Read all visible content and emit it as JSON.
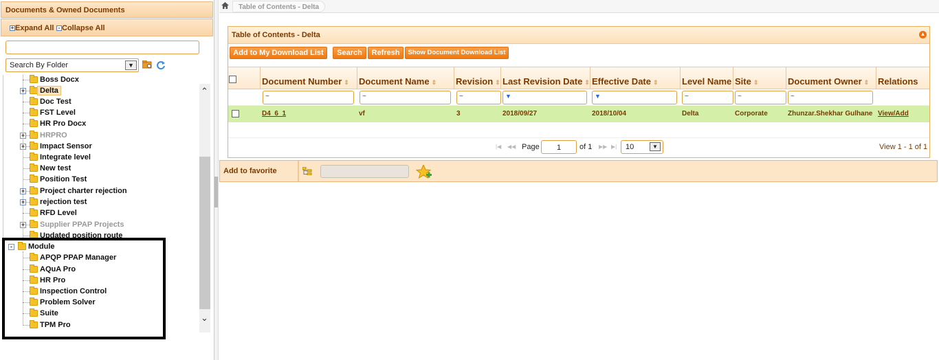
{
  "left_panel": {
    "title": "Documents & Owned Documents",
    "expand_all": "Expand All",
    "collapse_all": "Collapse All",
    "search_text_value": "",
    "search_by": "Search By Folder",
    "tree_items": [
      {
        "label": "Boss Docx"
      },
      {
        "label": "Delta"
      },
      {
        "label": "Doc Test"
      },
      {
        "label": "FST Level"
      },
      {
        "label": "HR Pro Docx"
      },
      {
        "label": "HRPRO"
      },
      {
        "label": "Impact Sensor"
      },
      {
        "label": "Integrate level"
      },
      {
        "label": "New test"
      },
      {
        "label": "Position Test"
      },
      {
        "label": "Project charter rejection"
      },
      {
        "label": "rejection test"
      },
      {
        "label": "RFD Level"
      },
      {
        "label": "Supplier PPAP Projects"
      },
      {
        "label": "Updated position route"
      }
    ],
    "module": {
      "label": "Module",
      "children": [
        {
          "label": "APQP PPAP Manager"
        },
        {
          "label": "AQuA Pro"
        },
        {
          "label": "HR Pro"
        },
        {
          "label": "Inspection Control"
        },
        {
          "label": "Problem Solver"
        },
        {
          "label": "Suite"
        },
        {
          "label": "TPM Pro"
        }
      ]
    }
  },
  "breadcrumb": {
    "current": "Table of Contents - Delta"
  },
  "panel": {
    "title": "Table of Contents - Delta",
    "buttons": {
      "add_download": "Add to My Download List",
      "search": "Search",
      "refresh": "Refresh",
      "show_download": "Show Document Download List"
    },
    "columns": {
      "doc_number": "Document Number",
      "doc_name": "Document Name",
      "revision": "Revision",
      "last_rev_date": "Last Revision Date",
      "effective_date": "Effective Date",
      "level_name": "Level Name",
      "site": "Site",
      "doc_owner": "Document Owner",
      "relations": "Relations"
    },
    "filter_symbol": "~",
    "row": {
      "doc_number": "D4_6_1",
      "doc_name": "vf",
      "revision": "3",
      "last_rev_date": "2018/09/27",
      "effective_date": "2018/10/04",
      "level_name": "Delta",
      "site": "Corporate",
      "doc_owner": "Zhunzar.Shekhar Gulhane",
      "relations": "View/Add"
    },
    "pager": {
      "page_label": "Page",
      "page_value": "1",
      "of_label": "of 1",
      "page_size": "10",
      "view_count": "View 1 - 1 of 1"
    }
  },
  "favorite": {
    "label": "Add to favorite",
    "input_value": ""
  },
  "colors": {
    "accent": "#ee7812",
    "header_text": "#7a3a00",
    "row_highlight": "#d4f0a8"
  }
}
